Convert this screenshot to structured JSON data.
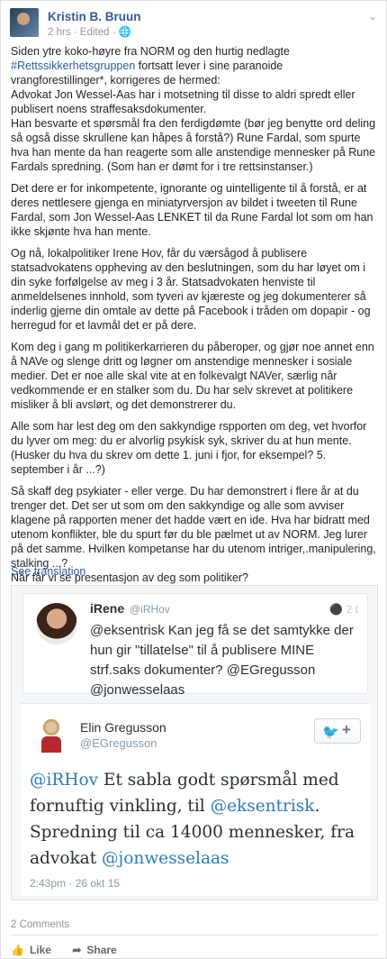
{
  "post": {
    "author": "Kristin B. Bruun",
    "meta": "2 hrs · Edited · 🌐",
    "menu_icon": "chevron-down-icon",
    "p1_a": "Siden ytre koko-høyre fra NORM og den hurtig nedlagte ",
    "p1_tag": "#Rettssikkerhetsgruppen",
    "p1_b": " fortsatt lever i sine paranoide vrangforestillinger*, korrigeres de hermed:",
    "p1_c": "Advokat Jon Wessel-Aas har i motsetning til disse to aldri spredt eller publisert noens straffesaksdokumenter.",
    "p1_d": "Han besvarte et spørsmål fra den ferdigdømte (bør jeg benytte ord deling så også disse skrullene kan håpes å forstå?) Rune Fardal, som spurte hva han mente da han reagerte som alle anstendige mennesker på Rune Fardals spredning. (Som han er dømt for i tre rettsinstanser.)",
    "p2": "Det dere er for inkompetente, ignorante og uintelligente til å forstå, er at deres nettlesere gjenga en miniatyrversjon av bildet i tweeten til Rune Fardal, som Jon Wessel-Aas LENKET til da Rune Fardal lot som om han ikke skjønte hva han mente.",
    "p3": "Og nå, lokalpolitiker Irene Hov, får du værsågod å publisere statsadvokatens oppheving av den beslutningen, som du har løyet om i din syke forfølgelse av meg i 3 år. Statsadvokaten henviste til anmeldelsenes innhold, som tyveri av kjæreste og jeg dokumenterer så inderlig gjerne din omtale av dette på Facebook i tråden om dopapir - og herregud for et lavmål det er på dere.",
    "p4": "Kom deg i gang m politikerkarrieren du påberoper, og gjør noe annet enn å NAVe og slenge dritt og løgner om anstendige mennesker i sosiale medier. Det er noe alle skal vite at en folkevalgt NAVer, særlig når vedkommende er en stalker som du. Du har selv skrevet at politikere misliker å bli avslørt, og det demonstrerer du.",
    "p5": "Alle som har lest deg om den sakkyndige rspporten om deg, vet hvorfor du lyver om meg: du er alvorlig psykisk syk, skriver du at hun mente. (Husker du hva du skrev om dette 1. juni i fjor, for eksempel? 5. september i år ...?)",
    "p6_a": "Så skaff deg psykiater - eller verge. Du har demonstrert i flere år at du trenger det. Det ser ut som om den sakkyndige og alle som avviser klagene på rapporten mener det hadde vært en ide. Hva har bidratt med utenom konflikter, ble du spurt før du ble pælmet ut av NORM. Jeg lurer på det samme. Hvilken kompetanse har du utenom intriger,.manipulering, stalking ...?",
    "p6_b": "Når får vi se presentasjon av deg som politiker?",
    "see_translation": "See translation"
  },
  "tweet_reply": {
    "name": "iRene",
    "handle": "@iRHov",
    "time": "2 t",
    "reply_icon": "speech-bubble-icon",
    "mention": "@eksentrisk",
    "text_a": " Kan jeg få se det samtykke der hun gir \"tillatelse\" til å publisere MINE strf.saks dokumenter? ",
    "mention2": "@EGregusson",
    "mention3": "@jonwesselaas"
  },
  "tweet_embed": {
    "name": "Elin Gregusson",
    "handle": "@EGregusson",
    "follow_icon": "twitter-bird-icon",
    "follow_plus": "+",
    "mention1": "@iRHov",
    "text_a": " Et sabla godt spørsmål med fornuftig vinkling, til ",
    "mention2": "@eksentrisk",
    "text_b": ". Spredning til ca 14000 mennesker, fra advokat ",
    "mention3": "@jonwesselaas",
    "time": "2:43pm · 26 okt 15"
  },
  "footer": {
    "comments": "2 Comments",
    "like": "Like",
    "share": "Share"
  },
  "colors": {
    "link": "#365899",
    "twitter_blue": "#55acee",
    "mention": "#2b7bb9"
  }
}
